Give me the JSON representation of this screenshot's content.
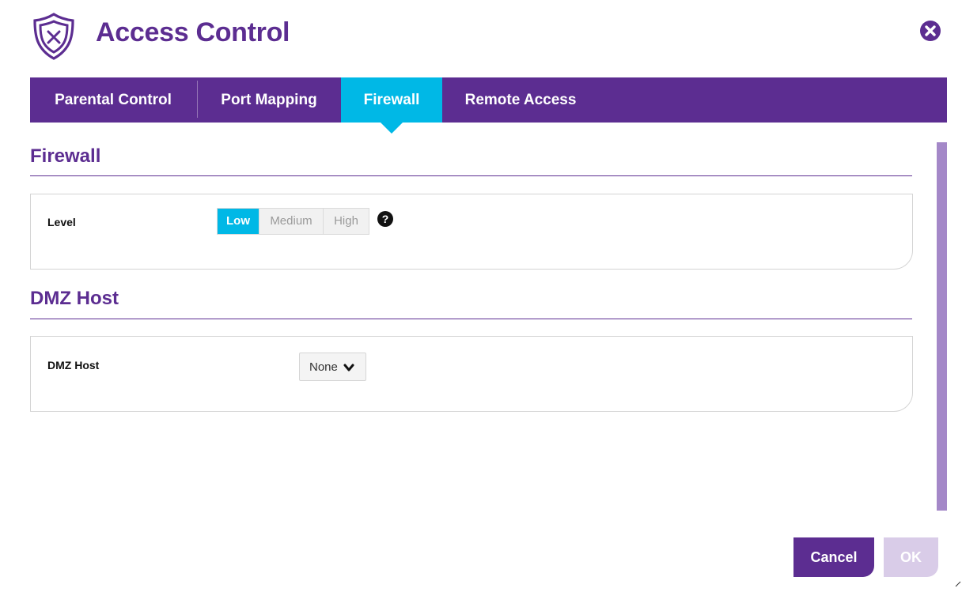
{
  "header": {
    "title": "Access Control",
    "icon": "shield-x-icon",
    "close_icon": "close-circle-icon"
  },
  "tabs": [
    {
      "label": "Parental Control",
      "active": false
    },
    {
      "label": "Port Mapping",
      "active": false
    },
    {
      "label": "Firewall",
      "active": true
    },
    {
      "label": "Remote Access",
      "active": false
    }
  ],
  "firewall": {
    "section_title": "Firewall",
    "level_label": "Level",
    "levels": [
      "Low",
      "Medium",
      "High"
    ],
    "selected_level": "Low",
    "help_icon": "question-circle-icon"
  },
  "dmz": {
    "section_title": "DMZ Host",
    "field_label": "DMZ Host",
    "selected": "None"
  },
  "footer": {
    "cancel_label": "Cancel",
    "ok_label": "OK"
  },
  "colors": {
    "brand_purple": "#5c2d91",
    "accent_cyan": "#00b8e6",
    "scrollbar": "#a488c8",
    "ok_disabled": "#d9cce8"
  }
}
